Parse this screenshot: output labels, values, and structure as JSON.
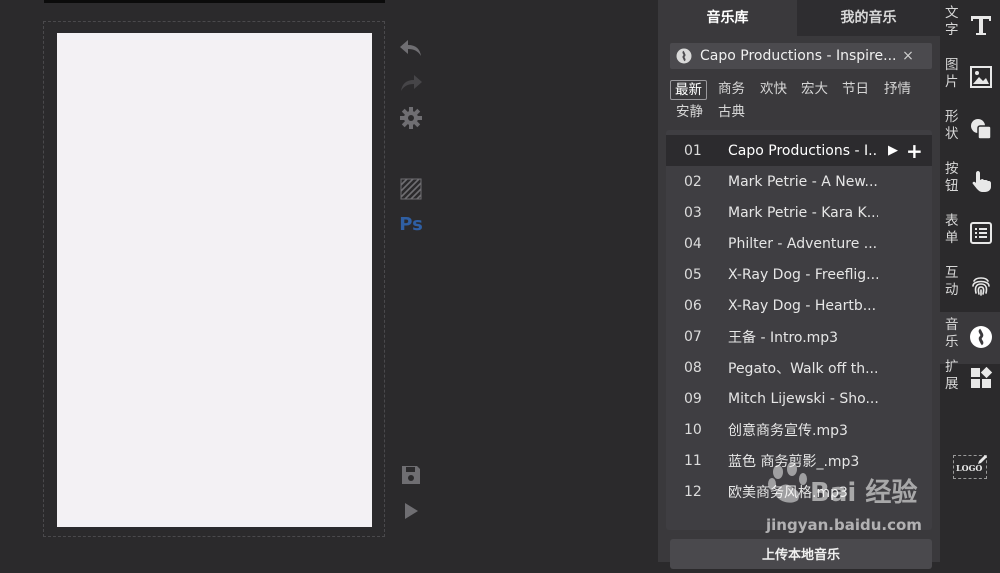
{
  "tabs": {
    "library": "音乐库",
    "mine": "我的音乐"
  },
  "current_track": {
    "title": "Capo Productions - Inspire....",
    "close_glyph": "×",
    "icon": "music-disc-icon"
  },
  "categories": [
    "最新",
    "商务",
    "欢快",
    "宏大",
    "节日",
    "抒情",
    "安静",
    "古典"
  ],
  "selected_category": "最新",
  "tracks": [
    {
      "num": "01",
      "name": "Capo Productions - I..."
    },
    {
      "num": "02",
      "name": "Mark Petrie - A New..."
    },
    {
      "num": "03",
      "name": "Mark Petrie - Kara K..."
    },
    {
      "num": "04",
      "name": "Philter - Adventure ..."
    },
    {
      "num": "05",
      "name": "X-Ray Dog - Freeflig..."
    },
    {
      "num": "06",
      "name": "X-Ray Dog - Heartb..."
    },
    {
      "num": "07",
      "name": "王备 - Intro.mp3"
    },
    {
      "num": "08",
      "name": "Pegato、Walk off th..."
    },
    {
      "num": "09",
      "name": "Mitch Lijewski - Sho..."
    },
    {
      "num": "10",
      "name": "创意商务宣传.mp3"
    },
    {
      "num": "11",
      "name": "蓝色 商务剪影_.mp3"
    },
    {
      "num": "12",
      "name": "欧美商务风格.mp3"
    }
  ],
  "row_actions": {
    "play": "▶",
    "add": "+"
  },
  "upload_label": "上传本地音乐",
  "sidebar": [
    {
      "label": "文字",
      "icon": "text-icon"
    },
    {
      "label": "图片",
      "icon": "image-icon"
    },
    {
      "label": "形状",
      "icon": "shapes-icon"
    },
    {
      "label": "按钮",
      "icon": "pointer-hand-icon"
    },
    {
      "label": "表单",
      "icon": "form-list-icon"
    },
    {
      "label": "互动",
      "icon": "fingerprint-icon"
    },
    {
      "label": "音乐",
      "icon": "music-disc-icon"
    },
    {
      "label": "扩展",
      "icon": "extensions-icon"
    }
  ],
  "sidebar_active": "音乐",
  "logo_label": "LOGO",
  "toolbar": {
    "ps_label": "Ps"
  },
  "watermark": {
    "brand": "Bai 经验",
    "url": "jingyan.baidu.com"
  },
  "colors": {
    "panel": "#3a393c",
    "background": "#2b2a2c",
    "page": "#f3f1f4",
    "ps_blue": "#2f5fa3"
  }
}
